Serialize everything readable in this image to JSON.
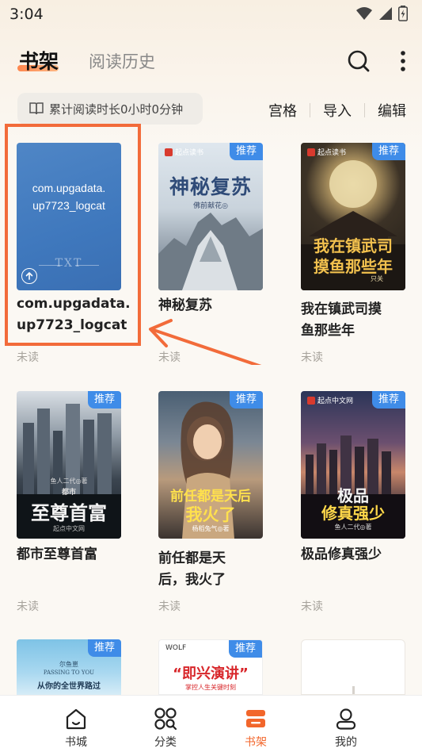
{
  "status_bar": {
    "time": "3:04"
  },
  "header": {
    "tab_active": "书架",
    "tab_history": "阅读历史",
    "search_icon": "search-icon",
    "more_icon": "more-vertical-icon",
    "accent": "#f2662b"
  },
  "reading": {
    "text": "累计阅读时长0小时0分钟"
  },
  "actions": {
    "grid": "宫格",
    "import": "导入",
    "edit": "编辑"
  },
  "books": [
    {
      "title": "com.upgadata.up7723_logcat",
      "title_line1": "com.upgadata.",
      "title_line2": "up7723_logcat",
      "status": "未读",
      "cover_line1": "com.upgadata.",
      "cover_line2": "up7723_logcat",
      "cover_label": "TXT"
    },
    {
      "title": "神秘复苏",
      "status": "未读",
      "badge": "推荐",
      "publisher": "起点读书",
      "cover_title": "神秘复苏",
      "cover_author": "佛前献花◎"
    },
    {
      "title": "我在镇武司摸鱼那些年",
      "title_line1": "我在镇武司摸",
      "title_line2": "鱼那些年",
      "status": "未读",
      "badge": "推荐",
      "publisher": "起点读书",
      "cover_title_1": "我在镇武司",
      "cover_title_2": "摸鱼那些年",
      "cover_author": "只关"
    },
    {
      "title": "都市至尊首富",
      "status": "未读",
      "badge": "推荐",
      "cover_author": "鱼人二代◎著",
      "cover_title": "至尊首富",
      "cover_small": "都市",
      "publisher_bottom": "起点中文网"
    },
    {
      "title": "前任都是天后，我火了",
      "title_line1": "前任都是天",
      "title_line2": "后，我火了",
      "status": "未读",
      "badge": "推荐",
      "cover_title_1": "前任都是天后",
      "cover_title_2": "我火了",
      "cover_author": "杨稻兔气◎著"
    },
    {
      "title": "极品修真强少",
      "status": "未读",
      "badge": "推荐",
      "publisher": "起点中文网",
      "cover_title_1": "极品",
      "cover_title_2": "修真强少",
      "cover_author": "鱼人二代◎著"
    },
    {
      "badge": "推荐",
      "cover_author": "尔鱼崽",
      "cover_text": "从你的全世界路过",
      "cover_small": "PASSING TO YOU"
    },
    {
      "badge": "推荐",
      "cover_text": "“即兴演讲”",
      "cover_small": "掌控人生关键时刻",
      "publisher": "WOLF"
    }
  ],
  "bottom_nav": [
    {
      "label": "书城",
      "icon": "home-icon"
    },
    {
      "label": "分类",
      "icon": "category-grid-icon"
    },
    {
      "label": "书架",
      "icon": "bookshelf-icon"
    },
    {
      "label": "我的",
      "icon": "profile-icon"
    }
  ]
}
